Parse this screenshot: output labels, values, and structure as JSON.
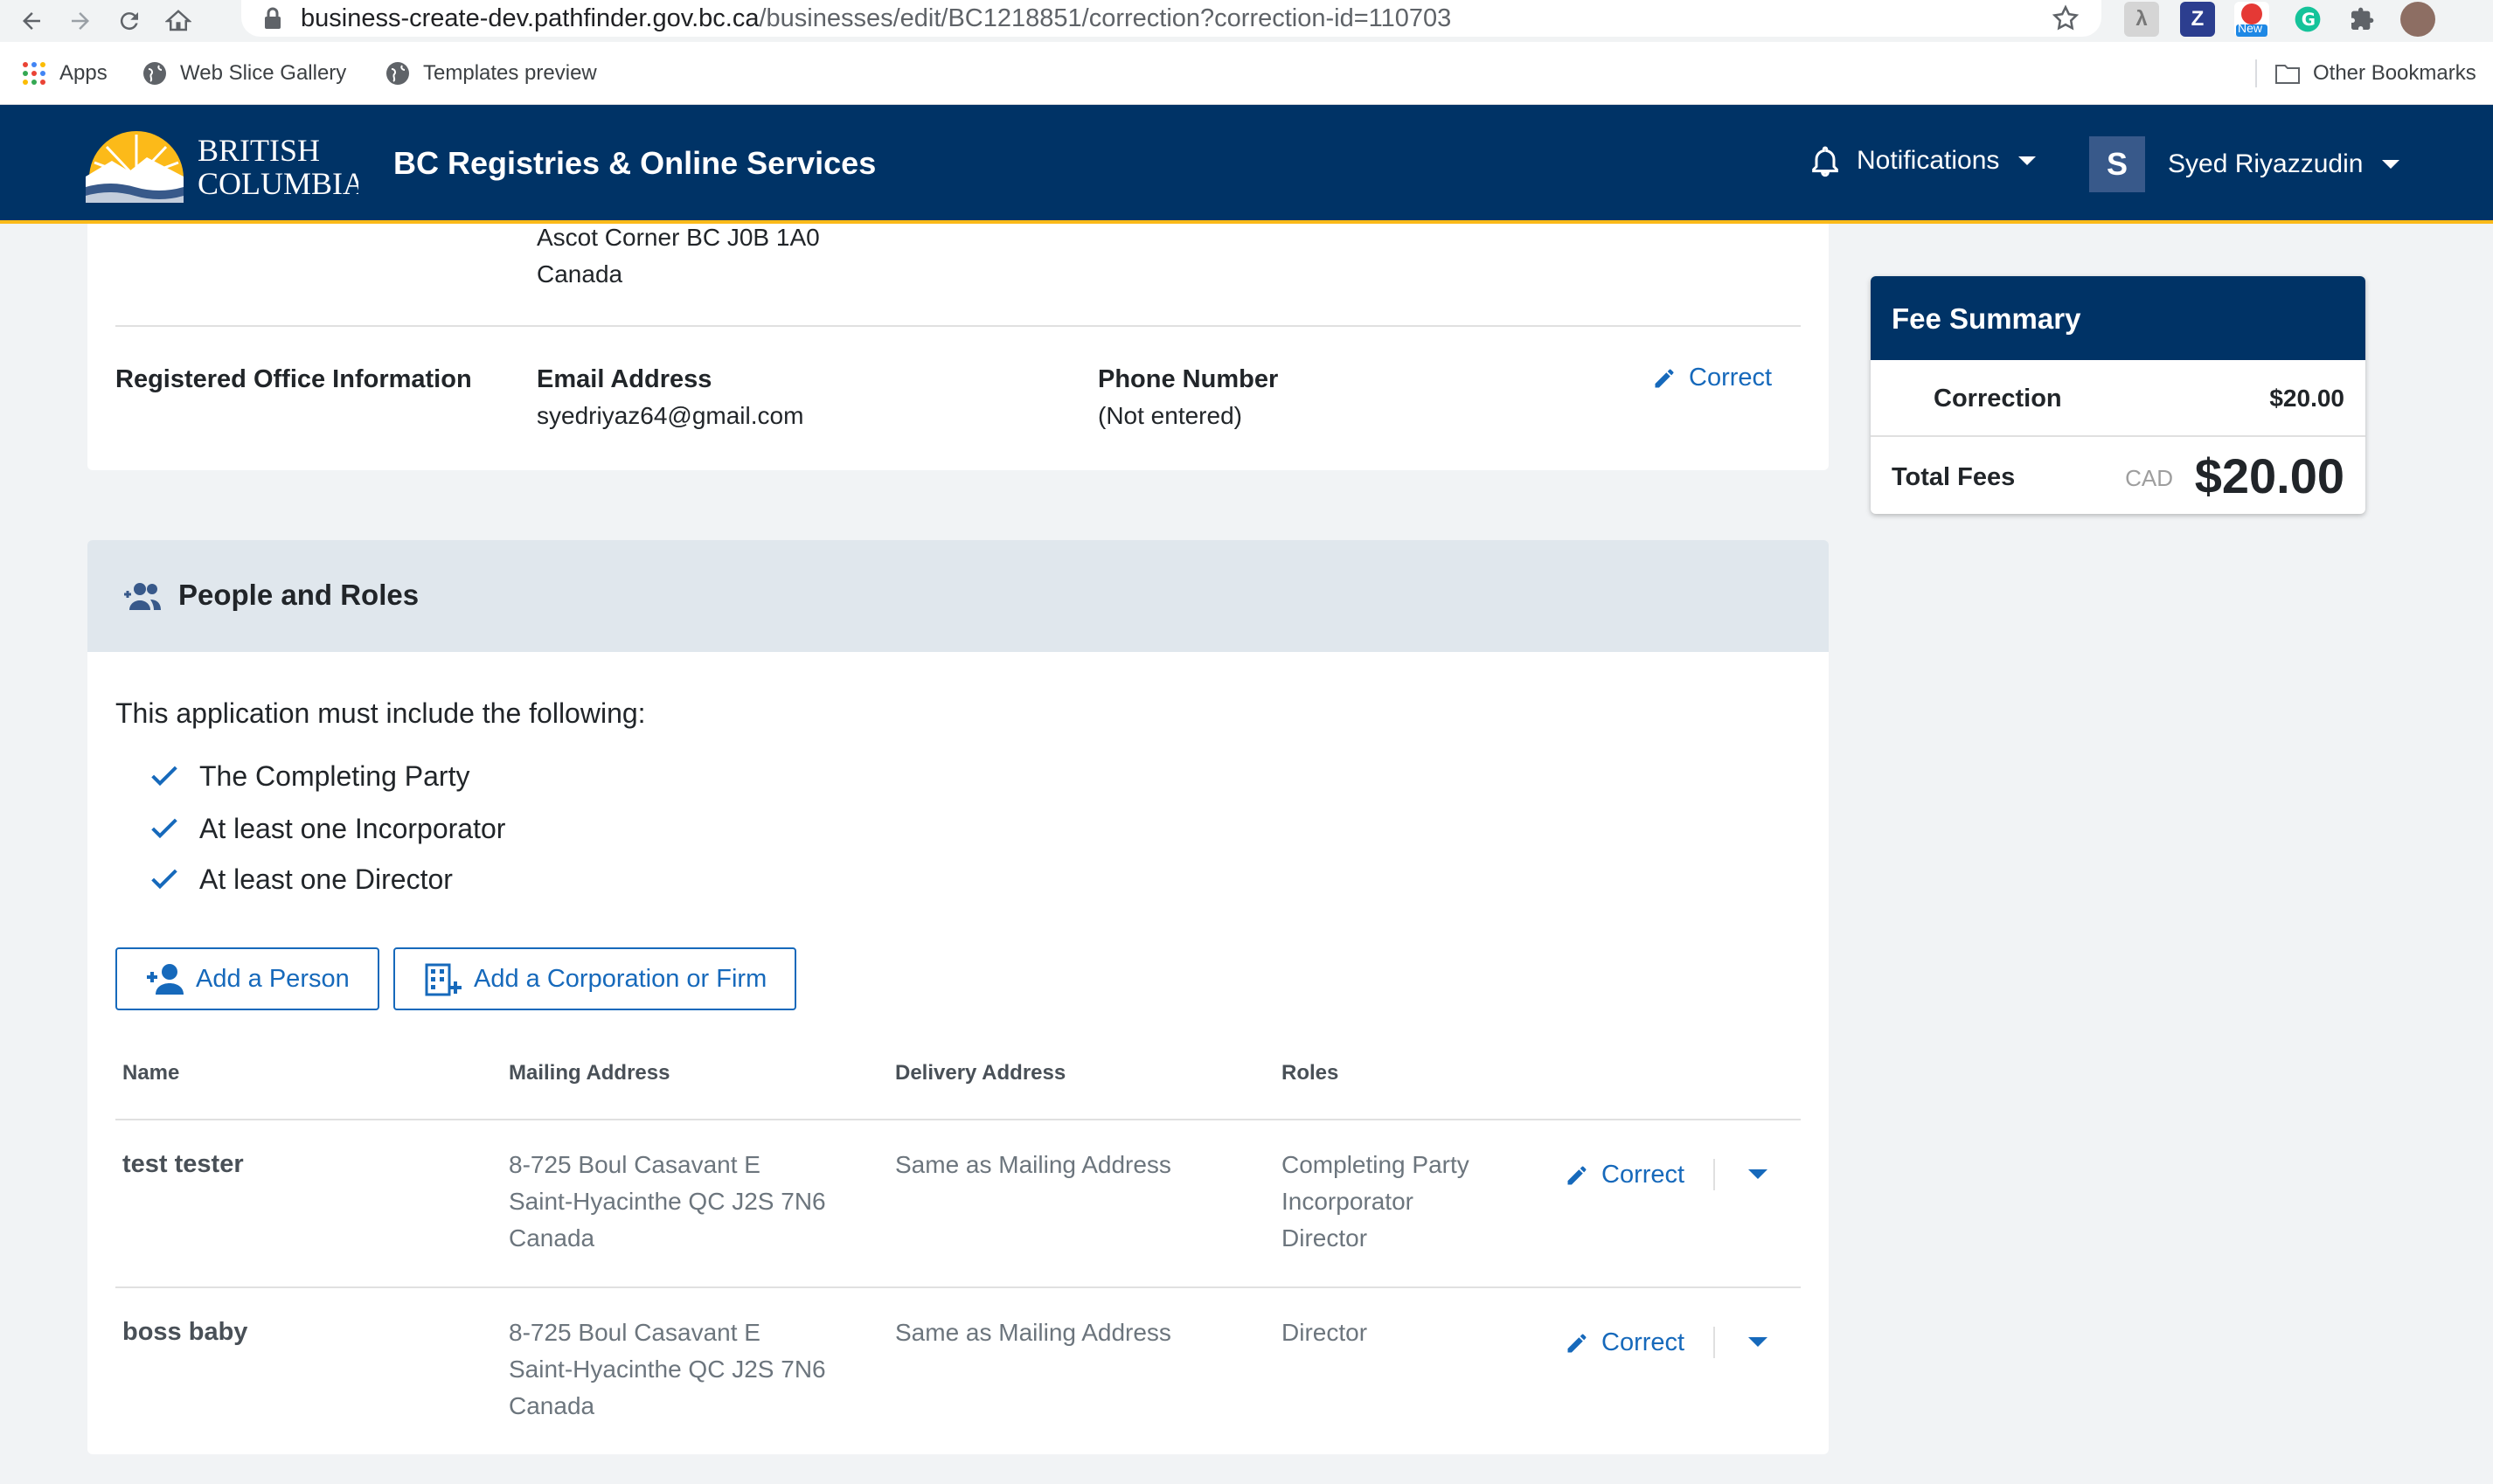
{
  "browser": {
    "url_host": "business-create-dev.pathfinder.gov.bc.ca",
    "url_path": "/businesses/edit/BC1218851/correction?correction-id=110703",
    "extension_badge": "New",
    "bookmarks": [
      "Apps",
      "Web Slice Gallery",
      "Templates preview"
    ],
    "other_bookmarks": "Other Bookmarks"
  },
  "header": {
    "logo_line1": "BRITISH",
    "logo_line2": "COLUMBIA",
    "title": "BC Registries & Online Services",
    "notifications": "Notifications",
    "avatar_initial": "S",
    "user_name": "Syed Riyazzudin"
  },
  "address_tail": {
    "line1": "Ascot Corner BC J0B 1A0",
    "line2": "Canada"
  },
  "office": {
    "section_label": "Registered Office Information",
    "email_label": "Email Address",
    "email_value": "syedriyaz64@gmail.com",
    "phone_label": "Phone Number",
    "phone_value": "(Not entered)",
    "correct_label": "Correct"
  },
  "people_roles": {
    "title": "People and Roles",
    "requirements_title": "This application must include the following:",
    "requirements": [
      "The Completing Party",
      "At least one Incorporator",
      "At least one Director"
    ],
    "add_person": "Add a Person",
    "add_corp": "Add a Corporation or Firm",
    "columns": [
      "Name",
      "Mailing Address",
      "Delivery Address",
      "Roles"
    ],
    "rows": [
      {
        "name": "test tester",
        "mailing": [
          "8-725 Boul Casavant E",
          "Saint-Hyacinthe QC J2S 7N6",
          "Canada"
        ],
        "delivery": "Same as Mailing Address",
        "roles": [
          "Completing Party",
          "Incorporator",
          "Director"
        ],
        "action": "Correct"
      },
      {
        "name": "boss baby",
        "mailing": [
          "8-725 Boul Casavant E",
          "Saint-Hyacinthe QC J2S 7N6",
          "Canada"
        ],
        "delivery": "Same as Mailing Address",
        "roles": [
          "Director"
        ],
        "action": "Correct"
      }
    ]
  },
  "fee_summary": {
    "title": "Fee Summary",
    "item_label": "Correction",
    "item_amount": "$20.00",
    "total_label": "Total Fees",
    "currency": "CAD",
    "total_amount": "$20.00"
  },
  "colors": {
    "brand_navy": "#003366",
    "brand_gold": "#fcba19",
    "link_blue": "#1669bb",
    "section_header": "#e0e7ed"
  }
}
